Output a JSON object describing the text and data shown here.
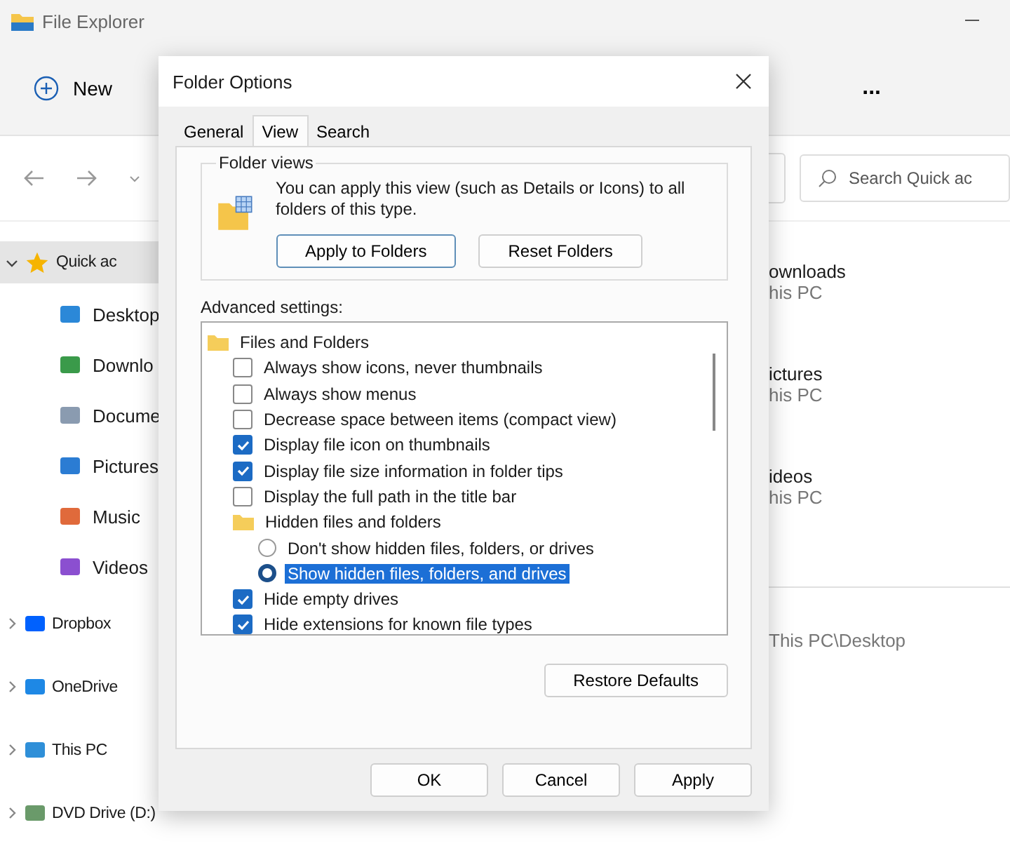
{
  "window": {
    "title": "File Explorer"
  },
  "toolbar": {
    "new_button": "New",
    "more_button": "..."
  },
  "search": {
    "placeholder": "Search Quick ac"
  },
  "sidebar": {
    "items": [
      {
        "label": "Quick ac",
        "expanded": true,
        "selected": true,
        "children": [
          {
            "label": "Desktop"
          },
          {
            "label": "Downlo"
          },
          {
            "label": "Docume"
          },
          {
            "label": "Pictures"
          },
          {
            "label": "Music"
          },
          {
            "label": "Videos"
          }
        ]
      },
      {
        "label": "Dropbox",
        "expanded": false,
        "selected": false
      },
      {
        "label": "OneDrive",
        "expanded": false,
        "selected": false
      },
      {
        "label": "This PC",
        "expanded": false,
        "selected": false
      },
      {
        "label": "DVD Drive (D:)",
        "expanded": false,
        "selected": false
      }
    ]
  },
  "content": {
    "folders": [
      {
        "name": "ownloads",
        "location": "his PC"
      },
      {
        "name": "ictures",
        "location": "his PC"
      },
      {
        "name": "ideos",
        "location": "his PC"
      }
    ],
    "recent": [
      {
        "location": "This PC\\Desktop"
      }
    ]
  },
  "dialog": {
    "title": "Folder Options",
    "tabs": [
      {
        "label": "General",
        "selected": false
      },
      {
        "label": "View",
        "selected": true
      },
      {
        "label": "Search",
        "selected": false
      }
    ],
    "folder_views": {
      "legend": "Folder views",
      "text": "You can apply this view (such as Details or Icons) to all folders of this type.",
      "buttons": [
        "Apply to Folders",
        "Reset Folders"
      ]
    },
    "advanced_label": "Advanced settings:",
    "settings": [
      {
        "kind": "folder",
        "label": "Files and Folders",
        "selected": false,
        "children": [
          {
            "kind": "checkbox",
            "label": "Always show icons, never thumbnails",
            "checked": false,
            "selected": false
          },
          {
            "kind": "checkbox",
            "label": "Always show menus",
            "checked": false,
            "selected": false
          },
          {
            "kind": "checkbox",
            "label": "Decrease space between items (compact view)",
            "checked": false,
            "selected": false
          },
          {
            "kind": "checkbox",
            "label": "Display file icon on thumbnails",
            "checked": true,
            "selected": false
          },
          {
            "kind": "checkbox",
            "label": "Display file size information in folder tips",
            "checked": true,
            "selected": false
          },
          {
            "kind": "checkbox",
            "label": "Display the full path in the title bar",
            "checked": false,
            "selected": false
          },
          {
            "kind": "folder",
            "label": "Hidden files and folders",
            "selected": false,
            "children": [
              {
                "kind": "radio",
                "label": "Don't show hidden files, folders, or drives",
                "checked": false,
                "selected": false
              },
              {
                "kind": "radio",
                "label": "Show hidden files, folders, and drives",
                "checked": true,
                "selected": true
              }
            ]
          },
          {
            "kind": "checkbox",
            "label": "Hide empty drives",
            "checked": true,
            "selected": false
          },
          {
            "kind": "checkbox",
            "label": "Hide extensions for known file types",
            "checked": true,
            "selected": false
          }
        ]
      }
    ],
    "restore_button": "Restore Defaults",
    "buttons": [
      "OK",
      "Cancel",
      "Apply"
    ]
  }
}
